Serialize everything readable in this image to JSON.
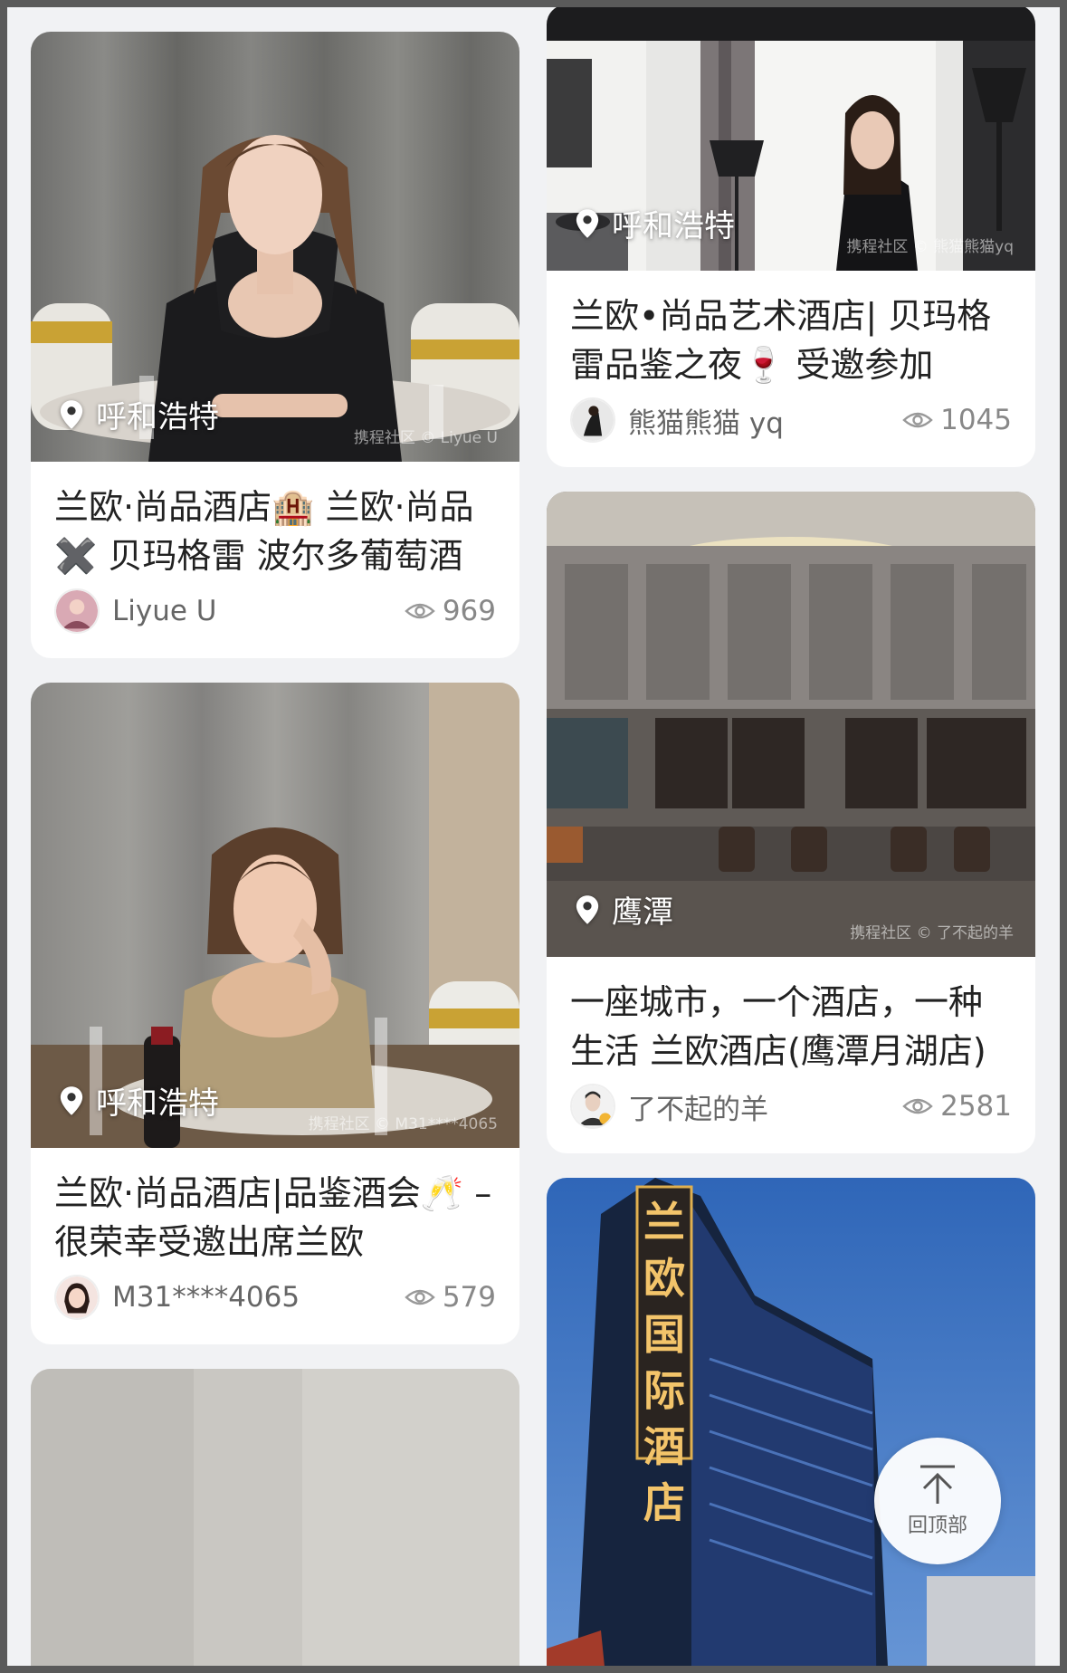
{
  "cards_left": [
    {
      "location": "呼和浩特",
      "watermark": "携程社区 © Liyue U",
      "title": "兰欧·尚品酒店🏨 兰欧·尚品 ✖️ 贝玛格雷 波尔多葡萄酒",
      "author": "Liyue U",
      "views": "969"
    },
    {
      "location": "呼和浩特",
      "watermark": "携程社区 © M31****4065",
      "title": "兰欧·尚品酒店|品鉴酒会🥂 – 很荣幸受邀出席兰欧",
      "author": "M31****4065",
      "views": "579"
    }
  ],
  "cards_right": [
    {
      "location": "呼和浩特",
      "watermark": "携程社区 © 熊猫熊猫yq",
      "title": "兰欧•尚品艺术酒店| 贝玛格雷品鉴之夜🍷 受邀参加",
      "author": "熊猫熊猫 yq",
      "views": "1045"
    },
    {
      "location": "鹰潭",
      "watermark": "携程社区 © 了不起的羊",
      "title": "一座城市，一个酒店，一种生活 兰欧酒店(鹰潭月湖店)",
      "author": "了不起的羊",
      "views": "2581"
    }
  ],
  "hotel_sign": "兰欧国际酒店",
  "back_to_top": "回顶部",
  "icons": {
    "location": "location-pin-icon",
    "views": "eye-icon",
    "back_to_top": "arrow-up-icon"
  }
}
